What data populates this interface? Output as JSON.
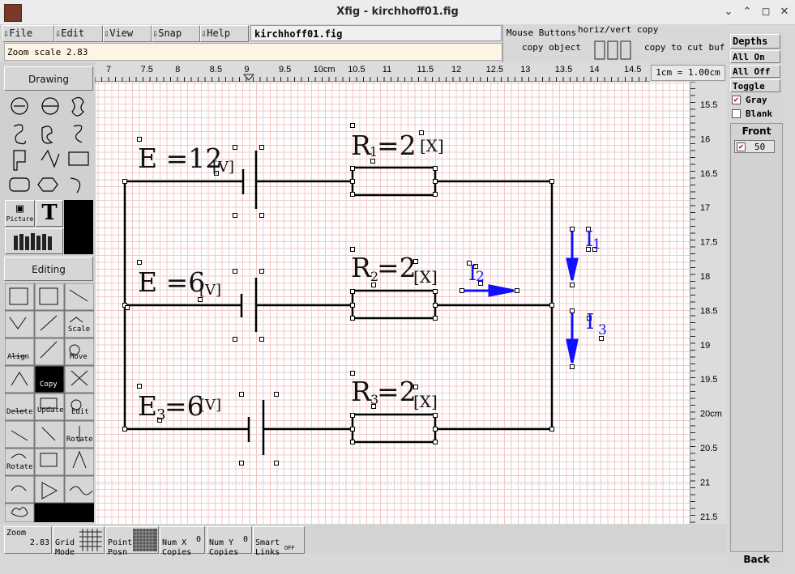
{
  "window": {
    "title": "Xfig - kirchhoff01.fig",
    "buttons": [
      "⌄",
      "⌃",
      "✕"
    ]
  },
  "menu": {
    "items": [
      "File",
      "Edit",
      "View",
      "Snap",
      "Help"
    ],
    "filename": "kirchhoff01.fig"
  },
  "zoom_info": "Zoom scale  2.83",
  "mouse_buttons": {
    "title": "Mouse Buttons",
    "left": "copy object",
    "middle": "horiz/vert copy",
    "right": "copy to cut buf"
  },
  "ruler": {
    "unit_label": "1cm = 1.00cm",
    "top_ticks": [
      "7",
      "7.5",
      "8",
      "8.5",
      "9",
      "9.5",
      "10cm",
      "10.5",
      "11",
      "11.5",
      "12",
      "12.5",
      "13",
      "13.5",
      "14",
      "14.5"
    ],
    "side_ticks": [
      "15.5",
      "16",
      "16.5",
      "17",
      "17.5",
      "18",
      "18.5",
      "19",
      "19.5",
      "20cm",
      "20.5",
      "21",
      "21.5"
    ]
  },
  "side_panel": {
    "drawing_label": "Drawing",
    "editing_label": "Editing",
    "drawing_tools": [
      "circle-radius-tool",
      "circle-diameter-tool",
      "ellipse-tool",
      "spline-open-tool",
      "spline-closed-tool",
      "spline-interp-tool",
      "polyline-tool",
      "polygon-tool",
      "box-tool",
      "rounded-box-tool",
      "regular-polygon-tool",
      "arc-tool",
      "picture-tool",
      "text-tool",
      "library-tool"
    ],
    "picture_label": "Picture",
    "text_label": "T",
    "editing_labels": {
      "scale": "Scale",
      "align": "Align",
      "move": "Move",
      "copy": "Copy",
      "delete": "Delete",
      "update": "Update",
      "edit": "Edit",
      "rotate1": "Rotate",
      "rotate2": "Rotate"
    }
  },
  "bottom_bar": {
    "zoom": {
      "label": "Zoom",
      "value": "2.83"
    },
    "grid": {
      "label": "Grid\nMode"
    },
    "point": {
      "label": "Point\nPosn"
    },
    "num_x": {
      "label": "Num X\nCopies",
      "value": "0"
    },
    "num_y": {
      "label": "Num Y\nCopies",
      "value": "0"
    },
    "smart": {
      "label": "Smart\nLinks",
      "value": "OFF"
    }
  },
  "right_panel": {
    "depths_label": "Depths",
    "all_on": "All On",
    "all_off": "All Off",
    "toggle": "Toggle",
    "gray": "Gray",
    "blank": "Blank",
    "front_label": "Front",
    "depth_value": "50",
    "back_label": "Back"
  },
  "circuit": {
    "e1": {
      "label": "E =12",
      "unit": "[V]"
    },
    "e2": {
      "label": "E =6",
      "unit": "[V]"
    },
    "e3": {
      "label": "E",
      "sub": "3",
      "rest": "=6",
      "unit": "[V]"
    },
    "r1": {
      "label": "R",
      "sub": "1",
      "rest": "=2",
      "unit": "[X]"
    },
    "r2": {
      "label": "R",
      "sub": "2",
      "rest": "=2",
      "unit": "[X]"
    },
    "r3": {
      "label": "R",
      "sub": "3",
      "rest": "=2",
      "unit": "[X]"
    },
    "i1": {
      "label": "I",
      "sub": "1"
    },
    "i2": {
      "label": "I",
      "sub": "2"
    },
    "i3": {
      "label": "I",
      "sub": "3"
    }
  },
  "colors": {
    "current_arrow": "#1010ff",
    "grid_line": "#f2c8c8",
    "canvas_bg": "#ffffff"
  }
}
